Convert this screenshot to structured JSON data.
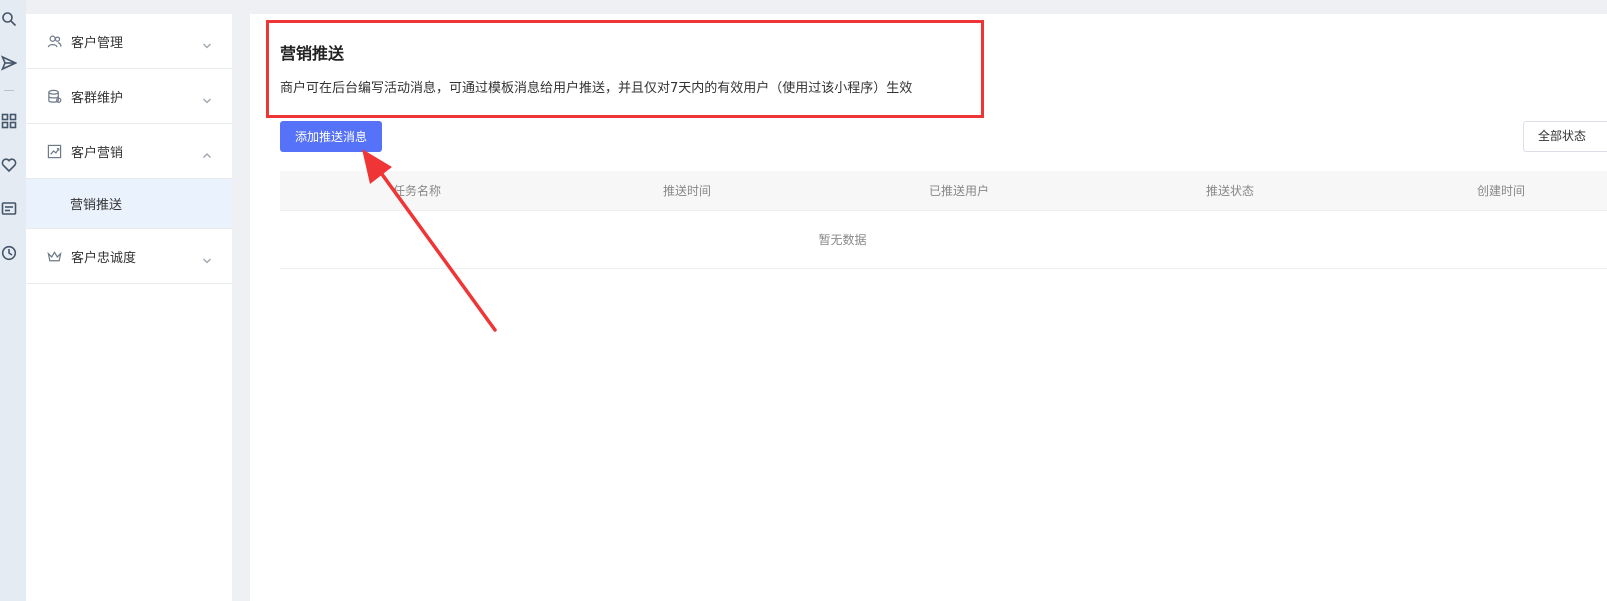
{
  "rail": {
    "icons": [
      "search-icon",
      "send-icon",
      "grid-icon",
      "heart-icon",
      "message-icon",
      "clock-icon"
    ]
  },
  "submenu": {
    "items": [
      {
        "label": "客户管理",
        "icon": "users-icon",
        "expanded": false
      },
      {
        "label": "客群维护",
        "icon": "database-icon",
        "expanded": false
      },
      {
        "label": "客户营销",
        "icon": "chart-icon",
        "expanded": true,
        "children": [
          {
            "label": "营销推送",
            "active": true
          }
        ]
      },
      {
        "label": "客户忠诚度",
        "icon": "crown-icon",
        "expanded": false
      }
    ]
  },
  "notice": {
    "title": "营销推送",
    "description": "商户可在后台编写活动消息，可通过模板消息给用户推送，并且仅对7天内的有效用户（使用过该小程序）生效"
  },
  "toolbar": {
    "add_label": "添加推送消息",
    "filter_label": "全部状态"
  },
  "table": {
    "columns": [
      "任务名称",
      "推送时间",
      "已推送用户",
      "推送状态",
      "创建时间"
    ],
    "empty_text": "暂无数据"
  },
  "colors": {
    "primary": "#5672f8",
    "highlight_border": "#ef3535",
    "annotation_arrow": "#ef3535",
    "active_menu_bg": "#eaf2fd"
  }
}
